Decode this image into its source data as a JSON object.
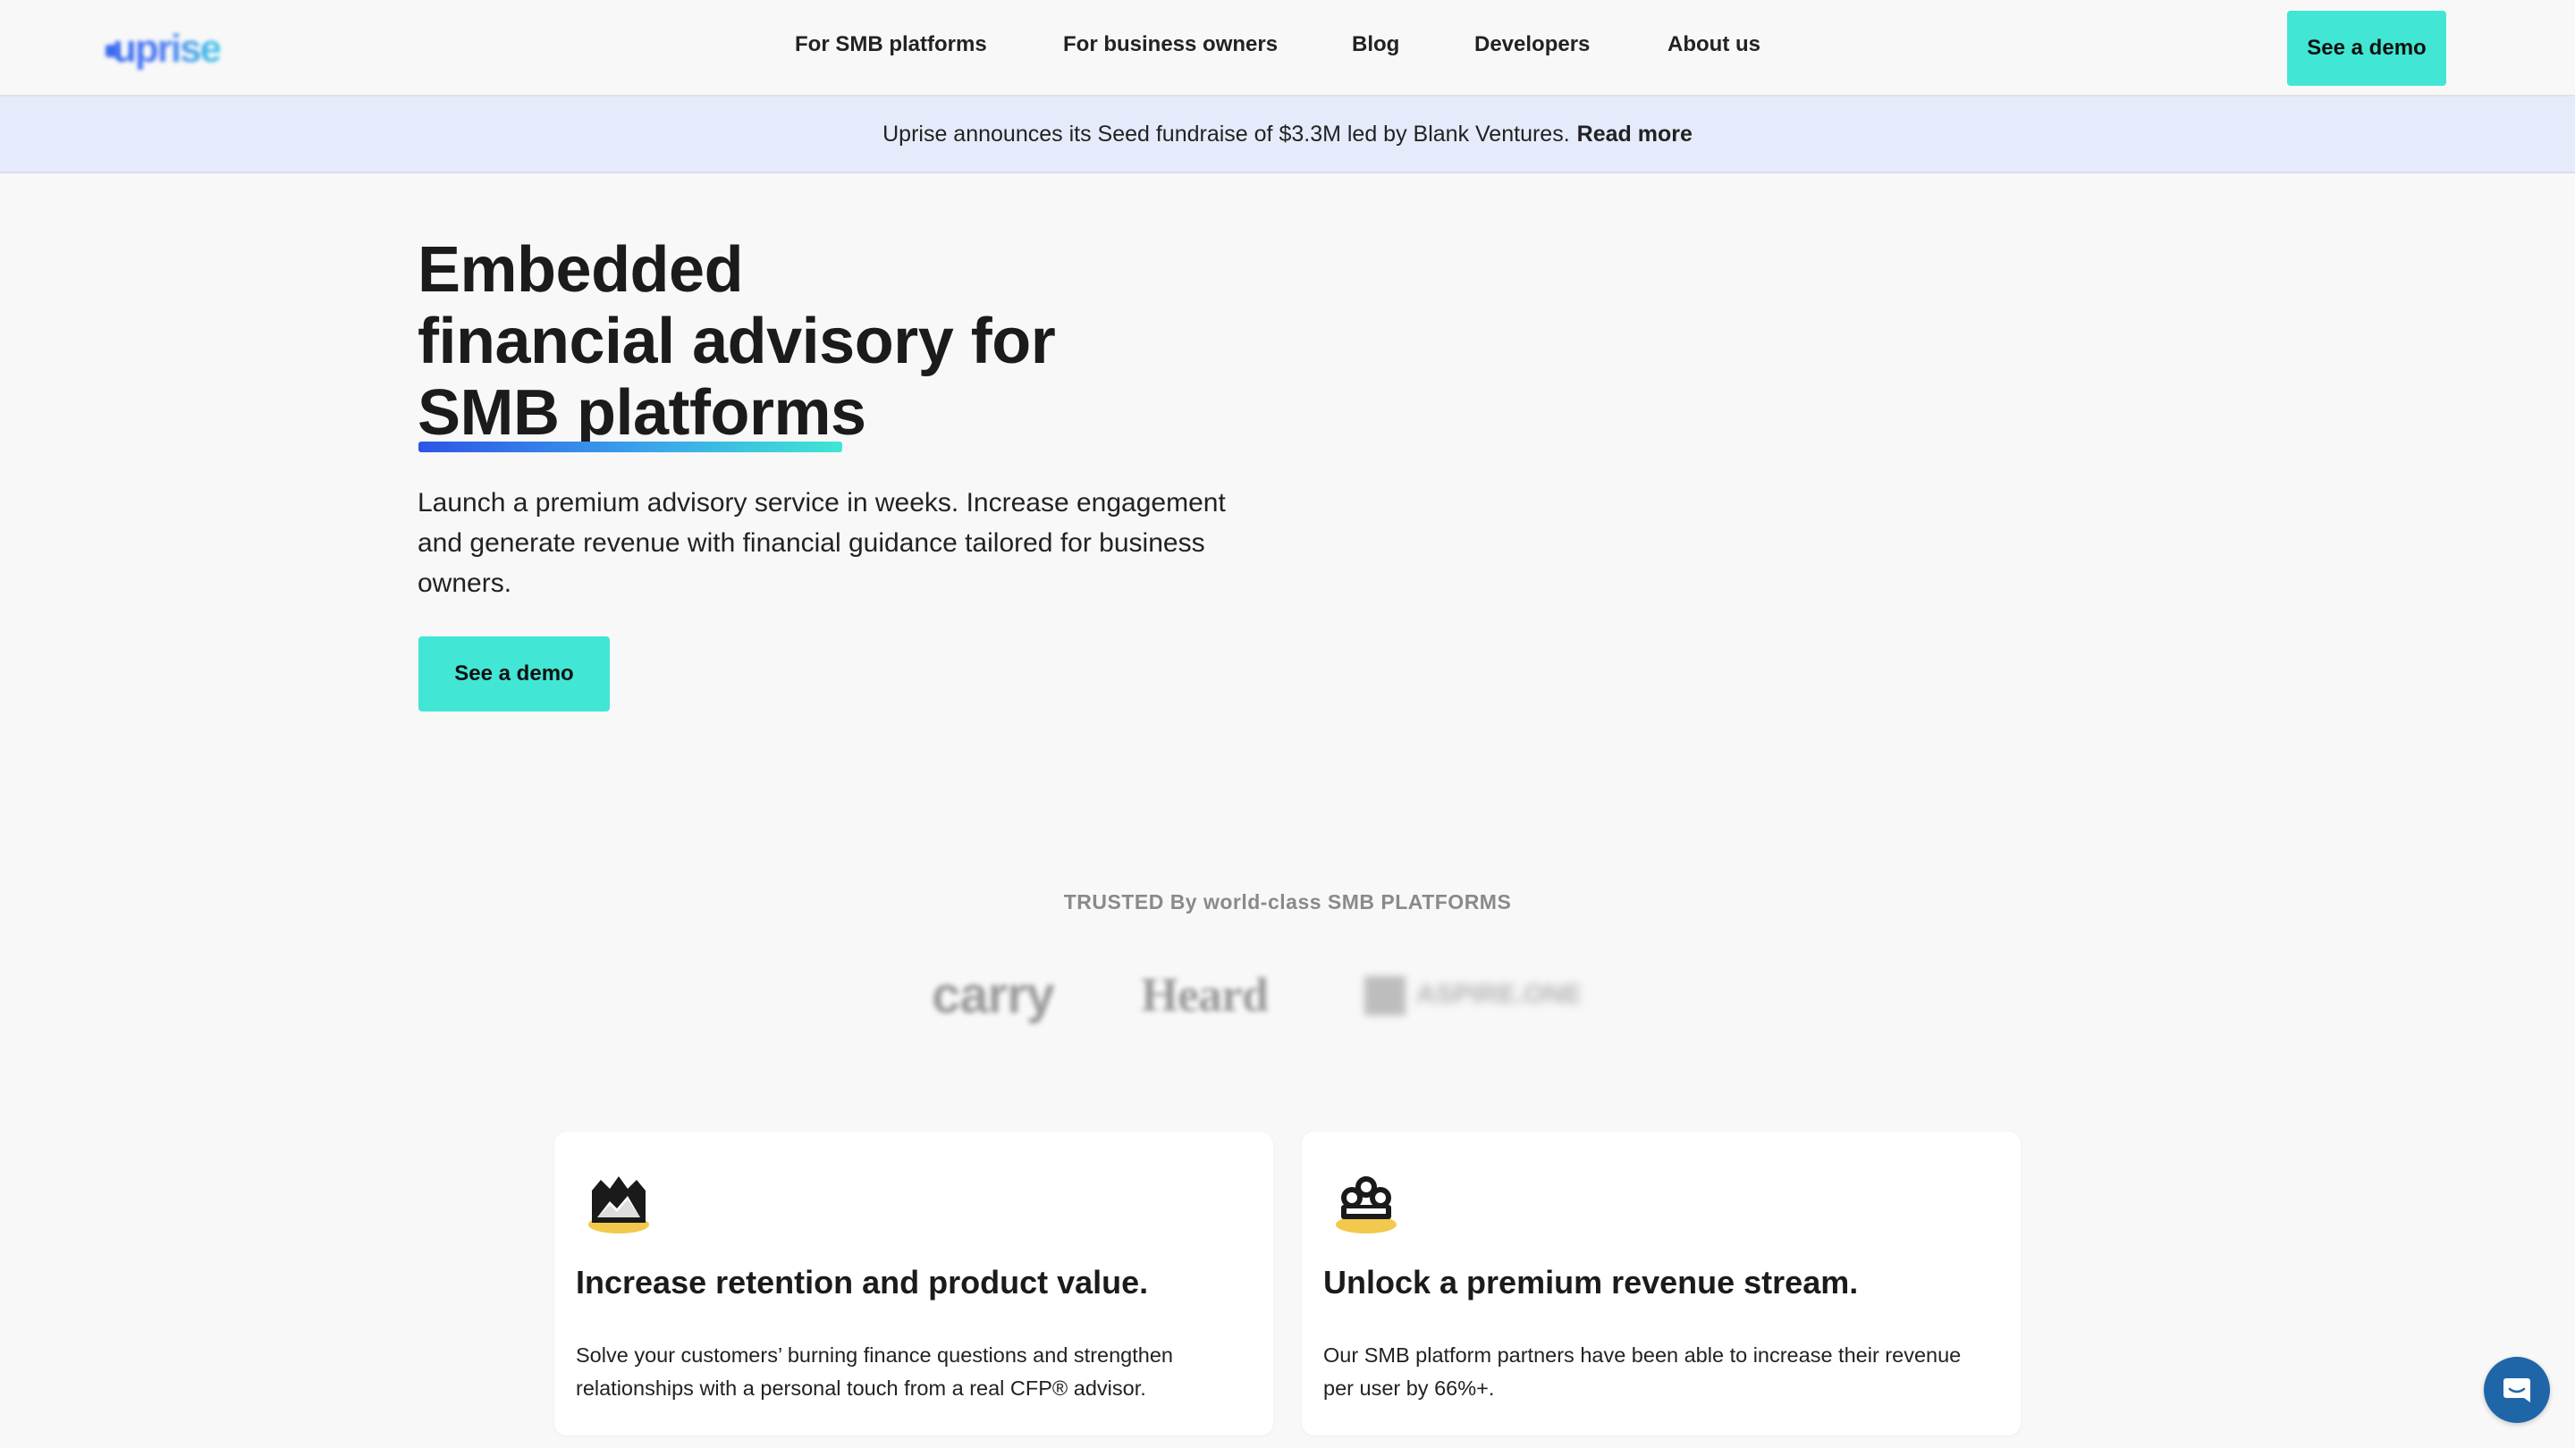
{
  "header": {
    "logo_text": "uprise",
    "nav": [
      {
        "label": "For SMB platforms"
      },
      {
        "label": "For business owners"
      },
      {
        "label": "Blog"
      },
      {
        "label": "Developers"
      },
      {
        "label": "About us"
      }
    ],
    "cta_label": "See a demo"
  },
  "announcement": {
    "text": "Uprise announces its Seed fundraise of $3.3M led by Blank Ventures.",
    "link_label": "Read more"
  },
  "hero": {
    "title_lines": [
      "Embedded",
      "financial advisory for",
      "SMB platforms"
    ],
    "subtitle": "Launch a premium advisory service in weeks. Increase engagement and generate revenue with financial guidance tailored for business owners.",
    "cta_label": "See a demo"
  },
  "trusted": {
    "heading": "TRUSTED By world-class SMB PLATFORMS",
    "partners": [
      "carry",
      "Heard",
      "ASPIRE.ONE"
    ]
  },
  "cards": [
    {
      "icon": "mountain-icon",
      "title": "Increase retention and product value.",
      "description": "Solve your customers’ burning finance questions and strengthen relationships with a personal touch from a real CFP® advisor."
    },
    {
      "icon": "crown-icon",
      "title": "Unlock a premium revenue stream.",
      "description": "Our SMB platform partners have been able to increase their revenue per user by 66%+."
    }
  ],
  "colors": {
    "accent": "#41e6d4",
    "announcement_bg": "#e5ebfa",
    "page_bg": "#f8f8f8",
    "chat": "#1f66a8"
  },
  "chat": {
    "icon": "chat-icon"
  }
}
